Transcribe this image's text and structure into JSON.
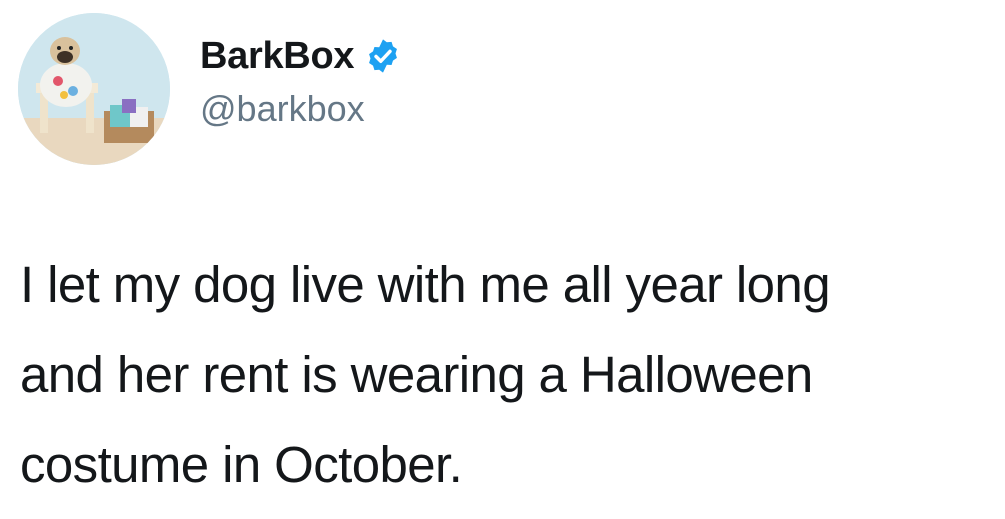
{
  "tweet": {
    "author": {
      "display_name": "BarkBox",
      "handle": "@barkbox",
      "verified": true,
      "verified_color": "#1da1f2"
    },
    "text_lines": [
      "I let my dog live with me all year long",
      "and her rent is wearing a Halloween",
      "costume in October."
    ]
  }
}
